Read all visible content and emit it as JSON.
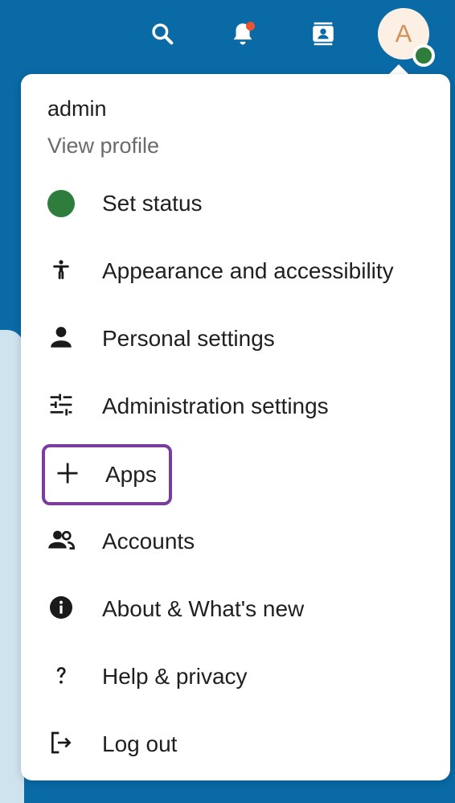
{
  "header": {
    "icons": [
      {
        "name": "search-icon"
      },
      {
        "name": "notifications-icon",
        "has_unread": true
      },
      {
        "name": "contacts-icon"
      }
    ],
    "avatar": {
      "initial": "A",
      "status": "online"
    }
  },
  "menu": {
    "profile": {
      "name": "admin",
      "link_label": "View profile"
    },
    "items": [
      {
        "label": "Set status",
        "icon": "status-dot-icon"
      },
      {
        "label": "Appearance and accessibility",
        "icon": "accessibility-icon"
      },
      {
        "label": "Personal settings",
        "icon": "person-icon"
      },
      {
        "label": "Administration settings",
        "icon": "sliders-icon"
      },
      {
        "label": "Apps",
        "icon": "plus-icon",
        "focused": true
      },
      {
        "label": "Accounts",
        "icon": "people-icon"
      },
      {
        "label": "About & What's new",
        "icon": "info-icon"
      },
      {
        "label": "Help & privacy",
        "icon": "question-icon"
      },
      {
        "label": "Log out",
        "icon": "logout-icon"
      }
    ]
  },
  "colors": {
    "header_bg": "#0a6aa6",
    "status_online": "#2f7d3c",
    "focus_ring": "#7a3d9f",
    "notification_dot": "#e9552f"
  }
}
